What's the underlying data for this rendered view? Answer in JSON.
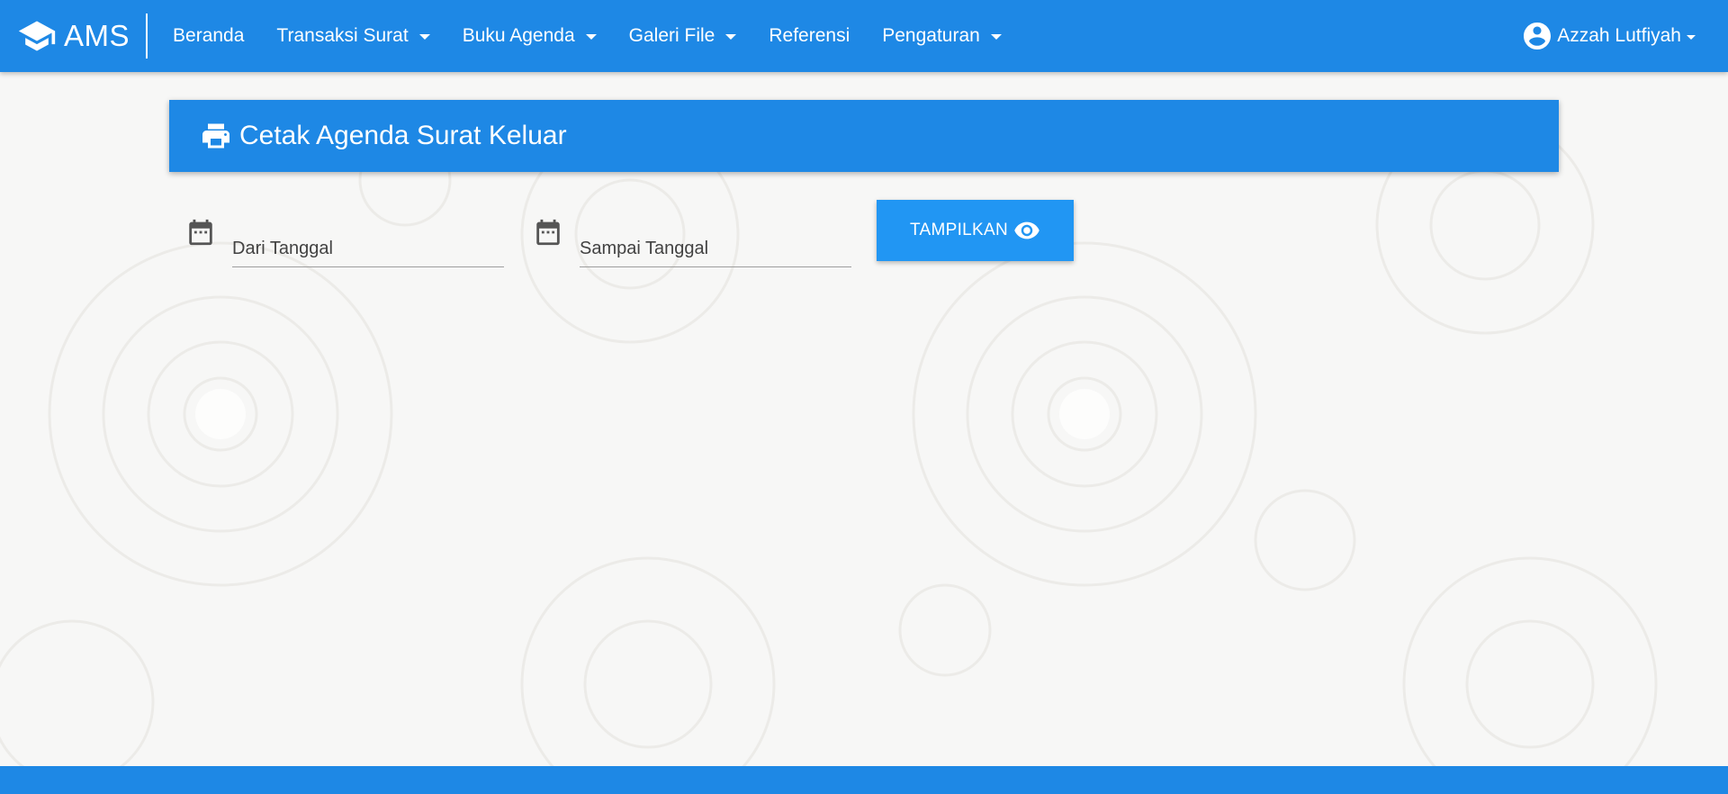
{
  "brand": {
    "name": "AMS",
    "icon": "graduation-cap-icon"
  },
  "nav": {
    "items": [
      {
        "label": "Beranda",
        "dropdown": false
      },
      {
        "label": "Transaksi Surat",
        "dropdown": true
      },
      {
        "label": "Buku Agenda",
        "dropdown": true
      },
      {
        "label": "Galeri File",
        "dropdown": true
      },
      {
        "label": "Referensi",
        "dropdown": false
      },
      {
        "label": "Pengaturan",
        "dropdown": true
      }
    ],
    "user": {
      "name": "Azzah Lutfiyah",
      "icon": "account-circle-icon"
    }
  },
  "page": {
    "title": "Cetak Agenda Surat Keluar",
    "title_icon": "printer-icon"
  },
  "form": {
    "from_date": {
      "placeholder": "Dari Tanggal",
      "value": "",
      "icon": "calendar-icon"
    },
    "to_date": {
      "placeholder": "Sampai Tanggal",
      "value": "",
      "icon": "calendar-icon"
    },
    "submit_label": "TAMPILKAN",
    "submit_icon": "eye-icon"
  },
  "colors": {
    "primary": "#1e88e5",
    "button": "#2196f3",
    "background": "#f7f7f6"
  }
}
